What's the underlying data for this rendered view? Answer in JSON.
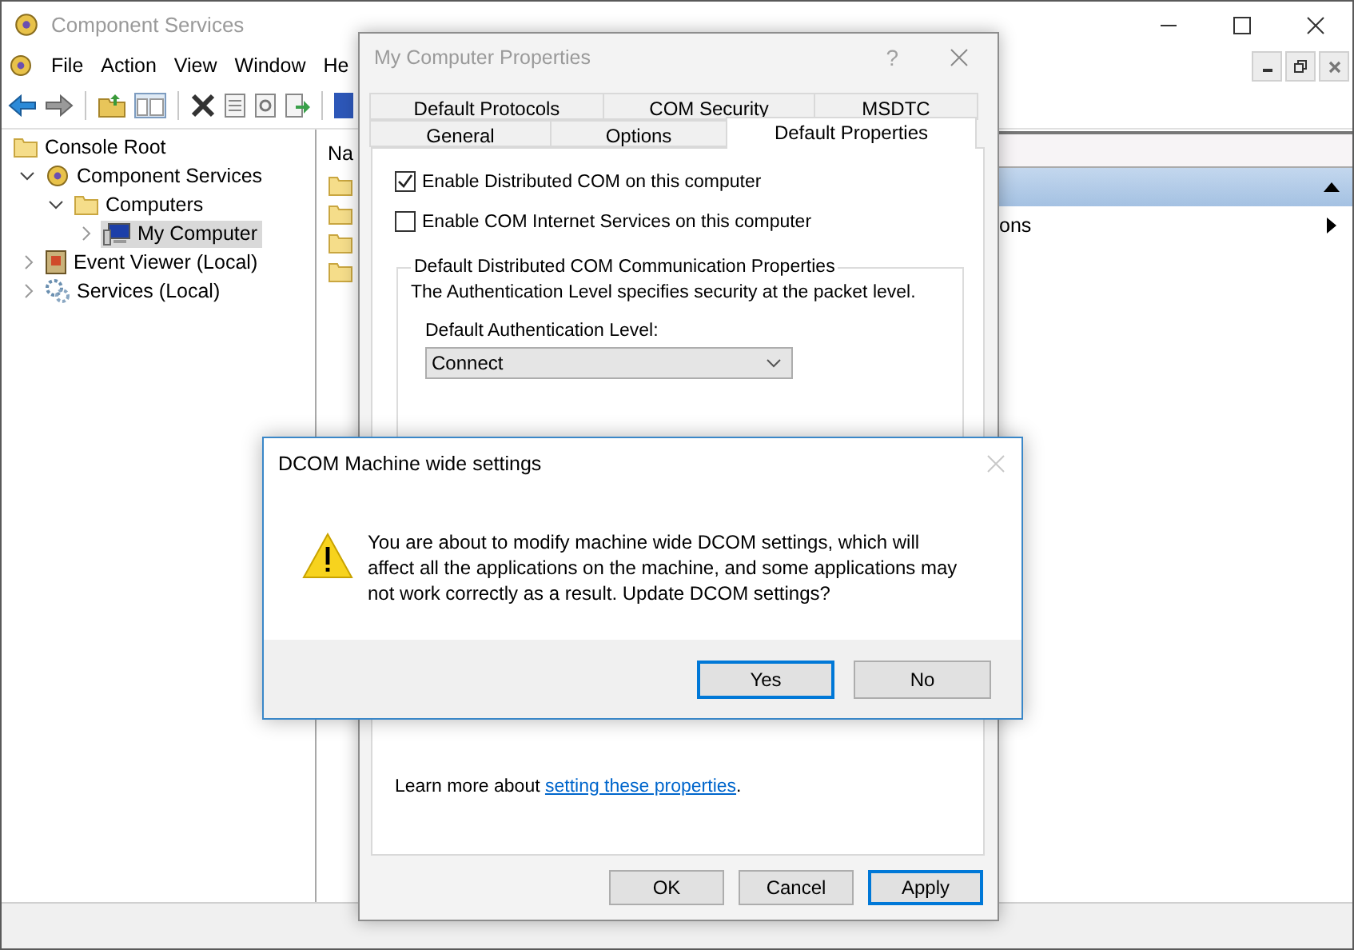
{
  "main_window": {
    "title": "Component Services",
    "menu": [
      "File",
      "Action",
      "View",
      "Window",
      "He"
    ],
    "tree": [
      {
        "label": "Console Root",
        "kind": "folder",
        "selected": false,
        "children": [
          {
            "label": "Component Services",
            "kind": "component",
            "selected": false,
            "expanded": true,
            "children": [
              {
                "label": "Computers",
                "kind": "folder",
                "selected": false,
                "expanded": true,
                "children": [
                  {
                    "label": "My Computer",
                    "kind": "computer",
                    "selected": true,
                    "expanded": false
                  }
                ]
              }
            ]
          },
          {
            "label": "Event Viewer (Local)",
            "kind": "log",
            "selected": false,
            "expanded": false
          },
          {
            "label": "Services (Local)",
            "kind": "service",
            "selected": false,
            "expanded": false
          }
        ]
      }
    ],
    "list_header": "Na",
    "actions": {
      "items": [
        {
          "label": "ons"
        }
      ]
    }
  },
  "properties_dialog": {
    "title": "My Computer Properties",
    "help": "?",
    "tab_rows": [
      [
        {
          "label": "Default Protocols",
          "selected": false
        },
        {
          "label": "COM Security",
          "selected": false
        },
        {
          "label": "MSDTC",
          "selected": false
        }
      ],
      [
        {
          "label": "General",
          "selected": false
        },
        {
          "label": "Options",
          "selected": false
        },
        {
          "label": "Default Properties",
          "selected": true
        }
      ]
    ],
    "checkboxes": [
      {
        "label": "Enable Distributed COM on this computer",
        "checked": true
      },
      {
        "label": "Enable COM Internet Services on this computer",
        "checked": false
      }
    ],
    "group": {
      "title": "Default Distributed COM Communication Properties",
      "description": "The Authentication Level specifies security at the packet level.",
      "field_label": "Default Authentication Level:",
      "value": "Connect"
    },
    "learn_more": {
      "text": "Learn more about ",
      "link": "setting these properties",
      "after": "."
    },
    "buttons": [
      {
        "label": "OK",
        "focused": false
      },
      {
        "label": "Cancel",
        "focused": false
      },
      {
        "label": "Apply",
        "focused": true
      }
    ]
  },
  "message_box": {
    "title": "DCOM Machine wide settings",
    "message": "You are about to modify machine wide DCOM settings, which will affect all the applications on the machine, and some applications may not work correctly as a result. Update DCOM settings?",
    "buttons": [
      {
        "label": "Yes",
        "focused": true
      },
      {
        "label": "No",
        "focused": false
      }
    ]
  }
}
